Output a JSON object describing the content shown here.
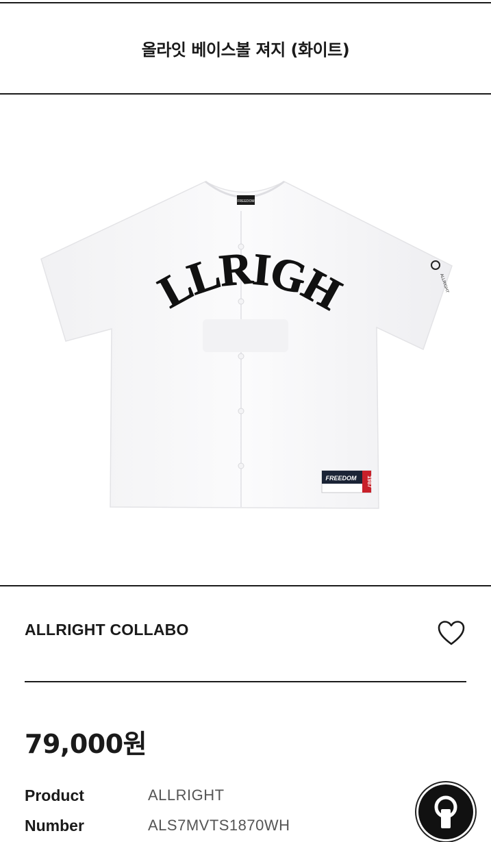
{
  "header": {
    "title": "올라잇 베이스볼 져지 (화이트)"
  },
  "product_image": {
    "alt": "ALLRIGHT",
    "front_print": "ALLRIGHT",
    "patch_text": "FREEDOM",
    "patch_year": "1987",
    "sleeve_text": "ALLRIGHT",
    "neck_label": "FREEDOM",
    "shirt_color": "#f9f9fa"
  },
  "brand": {
    "name": "ALLRIGHT COLLABO"
  },
  "price": {
    "text": "79,000원"
  },
  "info": [
    {
      "label": "Product",
      "value": "ALLRIGHT"
    },
    {
      "label": "Number",
      "value": "ALS7MVTS1870WH"
    }
  ],
  "icons": {
    "wishlist": "heart-outline-icon",
    "fab": "keyhole-icon"
  },
  "colors": {
    "text": "#1a1a1a",
    "value_gray": "#555555",
    "patch_red": "#c8202a",
    "patch_navy": "#1b2436"
  }
}
